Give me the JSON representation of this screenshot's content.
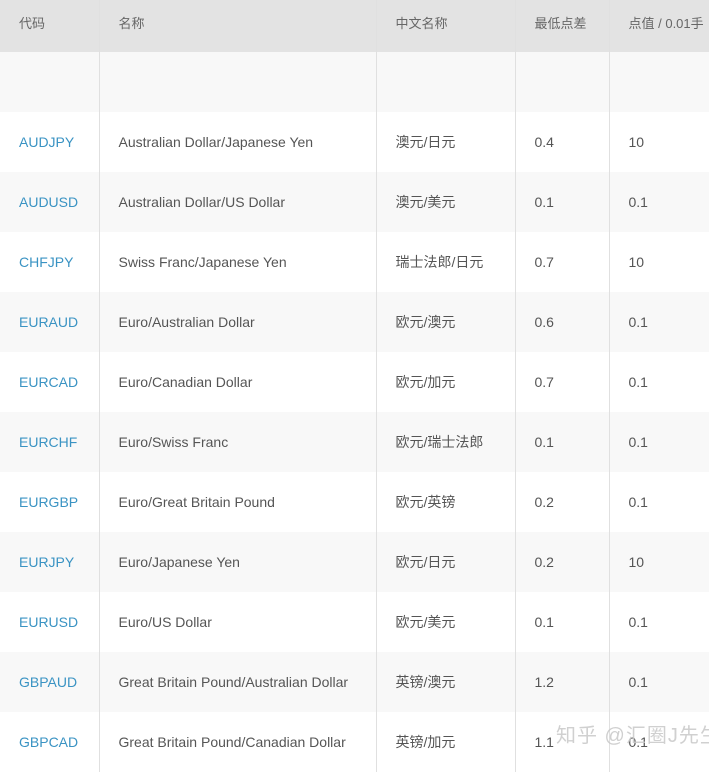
{
  "headers": [
    "代码",
    "名称",
    "中文名称",
    "最低点差",
    "点值 / 0.01手"
  ],
  "rows": [
    [
      "AUDJPY",
      "Australian Dollar/Japanese Yen",
      "澳元/日元",
      "0.4",
      "10"
    ],
    [
      "AUDUSD",
      "Australian Dollar/US Dollar",
      "澳元/美元",
      "0.1",
      "0.1"
    ],
    [
      "CHFJPY",
      "Swiss Franc/Japanese Yen",
      "瑞士法郎/日元",
      "0.7",
      "10"
    ],
    [
      "EURAUD",
      "Euro/Australian Dollar",
      "欧元/澳元",
      "0.6",
      "0.1"
    ],
    [
      "EURCAD",
      "Euro/Canadian Dollar",
      "欧元/加元",
      "0.7",
      "0.1"
    ],
    [
      "EURCHF",
      "Euro/Swiss Franc",
      "欧元/瑞士法郎",
      "0.1",
      "0.1"
    ],
    [
      "EURGBP",
      "Euro/Great Britain Pound",
      "欧元/英镑",
      "0.2",
      "0.1"
    ],
    [
      "EURJPY",
      "Euro/Japanese Yen",
      "欧元/日元",
      "0.2",
      "10"
    ],
    [
      "EURUSD",
      "Euro/US Dollar",
      "欧元/美元",
      "0.1",
      "0.1"
    ],
    [
      "GBPAUD",
      "Great Britain Pound/Australian Dollar",
      "英镑/澳元",
      "1.2",
      "0.1"
    ],
    [
      "GBPCAD",
      "Great Britain Pound/Canadian Dollar",
      "英镑/加元",
      "1.1",
      "0.1"
    ]
  ],
  "watermark": "知乎 @汇圈J先生"
}
